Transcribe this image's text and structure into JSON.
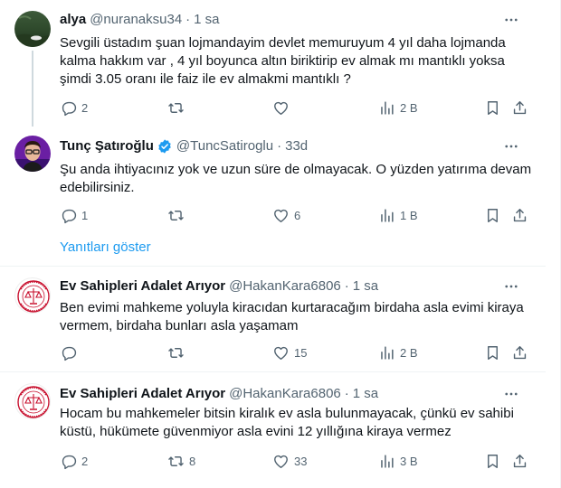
{
  "tweets": [
    {
      "name": "alya",
      "handle": "@nuranaksu34",
      "sep": "·",
      "time": "1 sa",
      "text": "Sevgili üstadım şuan lojmandayim devlet memuruyum 4 yıl daha lojmanda kalma hakkım var , 4 yıl boyunca altın biriktirip ev almak mı mantıklı yoksa şimdi 3.05 oranı ile faiz ile ev almakmi mantıklı ?",
      "replies": "2",
      "reposts": "",
      "likes": "",
      "views": "2 B"
    },
    {
      "name": "Tunç Şatıroğlu",
      "handle": "@TuncSatiroglu",
      "sep": "·",
      "time": "33d",
      "text": "Şu anda ihtiyacınız yok ve uzun süre de olmayacak. O yüzden yatırıma devam edebilirsiniz.",
      "replies": "1",
      "reposts": "",
      "likes": "6",
      "views": "1 B"
    },
    {
      "name": "Ev Sahipleri Adalet Arıyor",
      "handle": "@HakanKara6806",
      "sep": "·",
      "time": "1 sa",
      "text": "Ben evimi mahkeme yoluyla kiracıdan kurtaracağım birdaha asla evimi kiraya vermem, birdaha bunları asla yaşamam",
      "replies": "",
      "reposts": "",
      "likes": "15",
      "views": "2 B"
    },
    {
      "name": "Ev Sahipleri Adalet Arıyor",
      "handle": "@HakanKara6806",
      "sep": "·",
      "time": "1 sa",
      "text": "Hocam bu mahkemeler bitsin kiralık ev asla bulunmayacak, çünkü ev sahibi küstü, hükümete güvenmiyor asla evini 12 yıllığına kiraya vermez",
      "replies": "2",
      "reposts": "8",
      "likes": "33",
      "views": "3 B"
    }
  ],
  "show_replies": "Yanıtları göster",
  "icons": {
    "more": "more-icon",
    "reply": "reply-icon",
    "repost": "repost-icon",
    "like": "like-icon",
    "views": "views-icon",
    "bookmark": "bookmark-icon",
    "share": "share-icon",
    "verified": "verified-badge-icon"
  },
  "colors": {
    "text": "#0f1419",
    "muted": "#536471",
    "link": "#1d9bf0",
    "divider": "#eff3f4",
    "thread_line": "#cfd9de",
    "verified": "#1d9bf0"
  }
}
